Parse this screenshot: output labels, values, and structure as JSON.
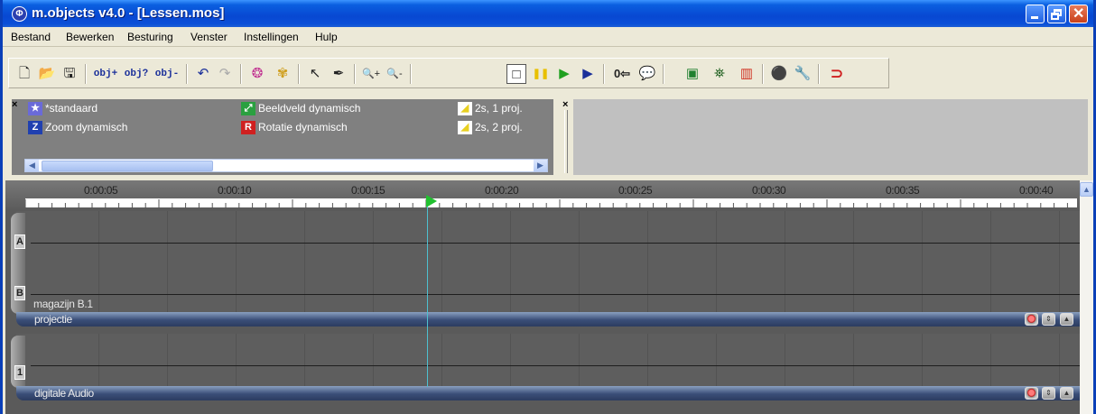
{
  "window": {
    "title": "m.objects v4.0 - [Lessen.mos]",
    "app_icon_glyph": "Φ"
  },
  "menu": [
    "Bestand",
    "Bewerken",
    "Besturing",
    "Venster",
    "Instellingen",
    "Hulp"
  ],
  "toolbar": {
    "buttons": [
      {
        "name": "new-file-icon",
        "glyph": "🗋"
      },
      {
        "name": "open-folder-icon",
        "glyph": "📂"
      },
      {
        "name": "save-icon",
        "glyph": "🖫"
      },
      {
        "name": "object-add-icon",
        "glyph": "obj+"
      },
      {
        "name": "object-query-icon",
        "glyph": "obj?"
      },
      {
        "name": "object-remove-icon",
        "glyph": "obj-"
      },
      {
        "name": "undo-icon",
        "glyph": "↶"
      },
      {
        "name": "redo-icon",
        "glyph": "↷"
      },
      {
        "name": "color-wheel-icon",
        "glyph": "❂"
      },
      {
        "name": "effects-icon",
        "glyph": "✾"
      },
      {
        "name": "pointer-tool-icon",
        "glyph": "↖"
      },
      {
        "name": "pen-tool-icon",
        "glyph": "✒"
      },
      {
        "name": "zoom-in-icon",
        "glyph": "🔍+"
      },
      {
        "name": "zoom-out-icon",
        "glyph": "🔍-"
      },
      {
        "name": "stop-icon",
        "glyph": "□"
      },
      {
        "name": "pause-icon",
        "glyph": "❚❚"
      },
      {
        "name": "play-icon",
        "glyph": "▶"
      },
      {
        "name": "goto-zero-icon",
        "glyph": "0⇦"
      },
      {
        "name": "comment-icon",
        "glyph": "💬"
      },
      {
        "name": "image-icon",
        "glyph": "▣"
      },
      {
        "name": "projector-icon",
        "glyph": "⛯"
      },
      {
        "name": "level-meter-icon",
        "glyph": "▥"
      },
      {
        "name": "devices-icon",
        "glyph": "⚫"
      },
      {
        "name": "settings-wrench-icon",
        "glyph": "🔧"
      },
      {
        "name": "magnet-icon",
        "glyph": "⊃"
      }
    ]
  },
  "presets": {
    "items": [
      {
        "label": "*standaard",
        "icon": "star-preset-icon",
        "icon_color": "#6a6ad8",
        "icon_glyph": "★"
      },
      {
        "label": "Beeldveld dynamisch",
        "icon": "image-field-icon",
        "icon_color": "#2aa040",
        "icon_glyph": "⤢"
      },
      {
        "label": "2s, 1 proj.",
        "icon": "fade-ramp-icon",
        "icon_color": "#e8d020",
        "icon_glyph": "◢"
      },
      {
        "label": "Zoom dynamisch",
        "icon": "zoom-z-icon",
        "icon_color": "#2040b0",
        "icon_glyph": "Z"
      },
      {
        "label": "Rotatie dynamisch",
        "icon": "rotation-r-icon",
        "icon_color": "#d02020",
        "icon_glyph": "R"
      },
      {
        "label": "2s, 2 proj.",
        "icon": "fade-ramp-icon",
        "icon_color": "#e8d020",
        "icon_glyph": "◢"
      }
    ]
  },
  "timeline": {
    "ruler_labels": [
      "0:00:05",
      "0:00:10",
      "0:00:15",
      "0:00:20",
      "0:00:25",
      "0:00:30",
      "0:00:35",
      "0:00:40"
    ],
    "projection": {
      "lanes": [
        "A",
        "B"
      ],
      "object_label": "magazijn B.1",
      "footer_label": "projectie"
    },
    "audio": {
      "lanes": [
        "1"
      ],
      "footer_label": "digitale Audio"
    }
  },
  "colors": {
    "titlebar": "#0a4fd8",
    "timeline_bg": "#5e5e5e",
    "playhead": "#4ec0d0",
    "play_marker": "#22c030"
  }
}
